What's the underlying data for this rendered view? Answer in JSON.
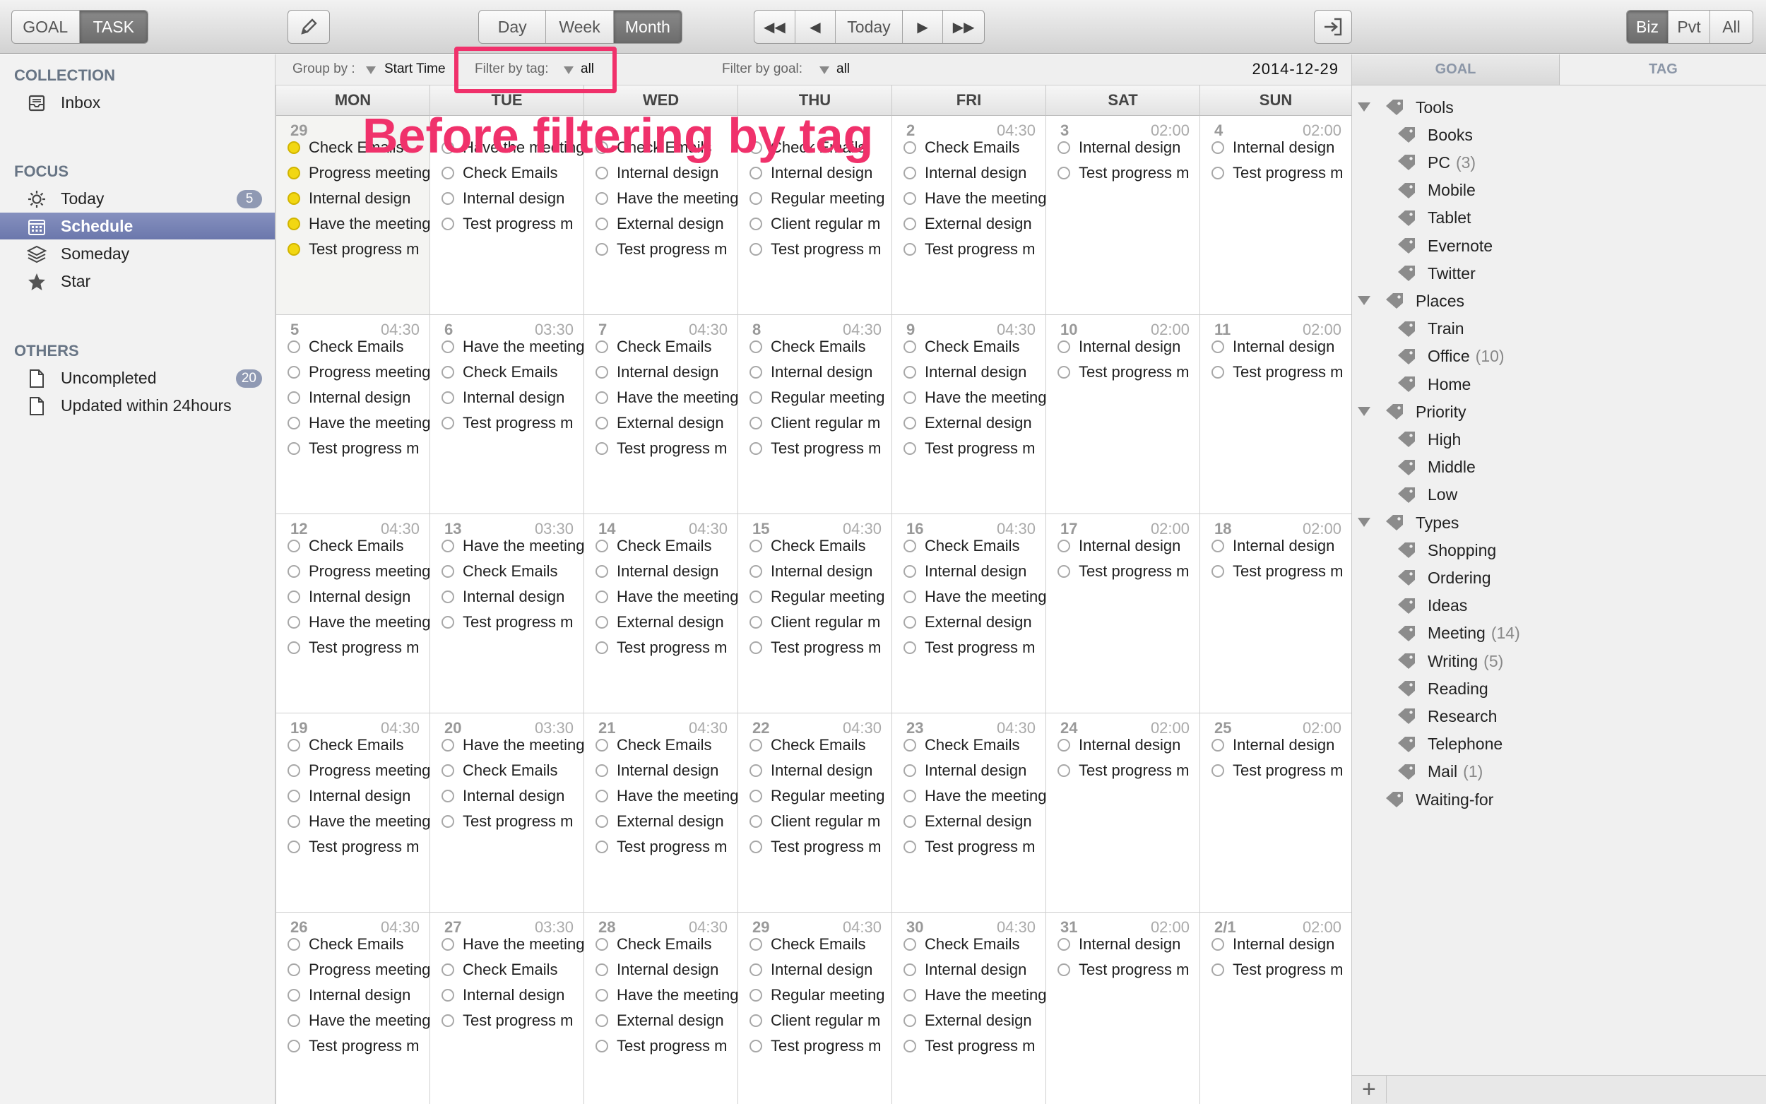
{
  "toolbar": {
    "mode_tabs": [
      "GOAL",
      "TASK"
    ],
    "view_tabs": [
      "Day",
      "Week",
      "Month"
    ],
    "today_label": "Today",
    "scope_tabs": [
      "Biz",
      "Pvt",
      "All"
    ]
  },
  "sidebar": {
    "collection_title": "COLLECTION",
    "inbox_label": "Inbox",
    "focus_title": "FOCUS",
    "focus_items": [
      {
        "label": "Today",
        "badge": "5",
        "icon": "sun-icon"
      },
      {
        "label": "Schedule",
        "icon": "calendar-icon"
      },
      {
        "label": "Someday",
        "icon": "layers-icon"
      },
      {
        "label": "Star",
        "icon": "star-icon"
      }
    ],
    "others_title": "OTHERS",
    "others_items": [
      {
        "label": "Uncompleted",
        "badge": "20",
        "icon": "document-icon"
      },
      {
        "label": "Updated within 24hours",
        "icon": "document-icon"
      }
    ]
  },
  "filter": {
    "group_label": "Group by :",
    "group_value": "Start Time",
    "tag_label": "Filter by tag:",
    "tag_value": "all",
    "goal_label": "Filter by goal:",
    "goal_value": "all",
    "current_date": "2014-12-29"
  },
  "overlay_text": "Before filtering by tag",
  "calendar": {
    "weekdays": [
      "MON",
      "TUE",
      "WED",
      "THU",
      "FRI",
      "SAT",
      "SUN"
    ],
    "weeks": [
      [
        {
          "day": "29",
          "time": "",
          "today": true,
          "tasks": [
            "Check Emails",
            "Progress meeting",
            "Internal design",
            "Have the meeting",
            "Test progress m"
          ]
        },
        {
          "day": "",
          "time": "",
          "tasks": [
            "Have the meeting",
            "Check Emails",
            "Internal design",
            "Test progress m"
          ]
        },
        {
          "day": "",
          "time": "",
          "tasks": [
            "Check Emails",
            "Internal design",
            "Have the meeting",
            "External design",
            "Test progress m"
          ]
        },
        {
          "day": "",
          "time": "",
          "tasks": [
            "Check Emails",
            "Internal design",
            "Regular meeting",
            "Client regular m",
            "Test progress m"
          ]
        },
        {
          "day": "2",
          "time": "04:30",
          "tasks": [
            "Check Emails",
            "Internal design",
            "Have the meeting",
            "External design",
            "Test progress m"
          ]
        },
        {
          "day": "3",
          "time": "02:00",
          "tasks": [
            "Internal design",
            "Test progress m"
          ]
        },
        {
          "day": "4",
          "time": "02:00",
          "tasks": [
            "Internal design",
            "Test progress m"
          ]
        }
      ],
      [
        {
          "day": "5",
          "time": "04:30",
          "tasks": [
            "Check Emails",
            "Progress meeting",
            "Internal design",
            "Have the meeting",
            "Test progress m"
          ]
        },
        {
          "day": "6",
          "time": "03:30",
          "tasks": [
            "Have the meeting",
            "Check Emails",
            "Internal design",
            "Test progress m"
          ]
        },
        {
          "day": "7",
          "time": "04:30",
          "tasks": [
            "Check Emails",
            "Internal design",
            "Have the meeting",
            "External design",
            "Test progress m"
          ]
        },
        {
          "day": "8",
          "time": "04:30",
          "tasks": [
            "Check Emails",
            "Internal design",
            "Regular meeting",
            "Client regular m",
            "Test progress m"
          ]
        },
        {
          "day": "9",
          "time": "04:30",
          "tasks": [
            "Check Emails",
            "Internal design",
            "Have the meeting",
            "External design",
            "Test progress m"
          ]
        },
        {
          "day": "10",
          "time": "02:00",
          "tasks": [
            "Internal design",
            "Test progress m"
          ]
        },
        {
          "day": "11",
          "time": "02:00",
          "tasks": [
            "Internal design",
            "Test progress m"
          ]
        }
      ],
      [
        {
          "day": "12",
          "time": "04:30",
          "tasks": [
            "Check Emails",
            "Progress meeting",
            "Internal design",
            "Have the meeting",
            "Test progress m"
          ]
        },
        {
          "day": "13",
          "time": "03:30",
          "tasks": [
            "Have the meeting",
            "Check Emails",
            "Internal design",
            "Test progress m"
          ]
        },
        {
          "day": "14",
          "time": "04:30",
          "tasks": [
            "Check Emails",
            "Internal design",
            "Have the meeting",
            "External design",
            "Test progress m"
          ]
        },
        {
          "day": "15",
          "time": "04:30",
          "tasks": [
            "Check Emails",
            "Internal design",
            "Regular meeting",
            "Client regular m",
            "Test progress m"
          ]
        },
        {
          "day": "16",
          "time": "04:30",
          "tasks": [
            "Check Emails",
            "Internal design",
            "Have the meeting",
            "External design",
            "Test progress m"
          ]
        },
        {
          "day": "17",
          "time": "02:00",
          "tasks": [
            "Internal design",
            "Test progress m"
          ]
        },
        {
          "day": "18",
          "time": "02:00",
          "tasks": [
            "Internal design",
            "Test progress m"
          ]
        }
      ],
      [
        {
          "day": "19",
          "time": "04:30",
          "tasks": [
            "Check Emails",
            "Progress meeting",
            "Internal design",
            "Have the meeting",
            "Test progress m"
          ]
        },
        {
          "day": "20",
          "time": "03:30",
          "tasks": [
            "Have the meeting",
            "Check Emails",
            "Internal design",
            "Test progress m"
          ]
        },
        {
          "day": "21",
          "time": "04:30",
          "tasks": [
            "Check Emails",
            "Internal design",
            "Have the meeting",
            "External design",
            "Test progress m"
          ]
        },
        {
          "day": "22",
          "time": "04:30",
          "tasks": [
            "Check Emails",
            "Internal design",
            "Regular meeting",
            "Client regular m",
            "Test progress m"
          ]
        },
        {
          "day": "23",
          "time": "04:30",
          "tasks": [
            "Check Emails",
            "Internal design",
            "Have the meeting",
            "External design",
            "Test progress m"
          ]
        },
        {
          "day": "24",
          "time": "02:00",
          "tasks": [
            "Internal design",
            "Test progress m"
          ]
        },
        {
          "day": "25",
          "time": "02:00",
          "tasks": [
            "Internal design",
            "Test progress m"
          ]
        }
      ],
      [
        {
          "day": "26",
          "time": "04:30",
          "tasks": [
            "Check Emails",
            "Progress meeting",
            "Internal design",
            "Have the meeting",
            "Test progress m"
          ]
        },
        {
          "day": "27",
          "time": "03:30",
          "tasks": [
            "Have the meeting",
            "Check Emails",
            "Internal design",
            "Test progress m"
          ]
        },
        {
          "day": "28",
          "time": "04:30",
          "tasks": [
            "Check Emails",
            "Internal design",
            "Have the meeting",
            "External design",
            "Test progress m"
          ]
        },
        {
          "day": "29",
          "time": "04:30",
          "tasks": [
            "Check Emails",
            "Internal design",
            "Regular meeting",
            "Client regular m",
            "Test progress m"
          ]
        },
        {
          "day": "30",
          "time": "04:30",
          "tasks": [
            "Check Emails",
            "Internal design",
            "Have the meeting",
            "External design",
            "Test progress m"
          ]
        },
        {
          "day": "31",
          "time": "02:00",
          "tasks": [
            "Internal design",
            "Test progress m"
          ]
        },
        {
          "day": "2/1",
          "time": "02:00",
          "tasks": [
            "Internal design",
            "Test progress m"
          ]
        }
      ]
    ]
  },
  "right_panel": {
    "tabs": [
      "GOAL",
      "TAG"
    ],
    "tree": [
      {
        "label": "Tools",
        "level": 0,
        "count": ""
      },
      {
        "label": "Books",
        "level": 1,
        "count": ""
      },
      {
        "label": "PC",
        "level": 1,
        "count": "(3)"
      },
      {
        "label": "Mobile",
        "level": 1,
        "count": ""
      },
      {
        "label": "Tablet",
        "level": 1,
        "count": ""
      },
      {
        "label": "Evernote",
        "level": 1,
        "count": ""
      },
      {
        "label": "Twitter",
        "level": 1,
        "count": ""
      },
      {
        "label": "Places",
        "level": 0,
        "count": ""
      },
      {
        "label": "Train",
        "level": 1,
        "count": ""
      },
      {
        "label": "Office",
        "level": 1,
        "count": "(10)"
      },
      {
        "label": "Home",
        "level": 1,
        "count": ""
      },
      {
        "label": "Priority",
        "level": 0,
        "count": ""
      },
      {
        "label": "High",
        "level": 1,
        "count": ""
      },
      {
        "label": "Middle",
        "level": 1,
        "count": ""
      },
      {
        "label": "Low",
        "level": 1,
        "count": ""
      },
      {
        "label": "Types",
        "level": 0,
        "count": ""
      },
      {
        "label": "Shopping",
        "level": 1,
        "count": ""
      },
      {
        "label": "Ordering",
        "level": 1,
        "count": ""
      },
      {
        "label": "Ideas",
        "level": 1,
        "count": ""
      },
      {
        "label": "Meeting",
        "level": 1,
        "count": "(14)"
      },
      {
        "label": "Writing",
        "level": 1,
        "count": "(5)"
      },
      {
        "label": "Reading",
        "level": 1,
        "count": ""
      },
      {
        "label": "Research",
        "level": 1,
        "count": ""
      },
      {
        "label": "Telephone",
        "level": 1,
        "count": ""
      },
      {
        "label": "Mail",
        "level": 1,
        "count": "(1)"
      },
      {
        "label": "Waiting-for",
        "level": 0,
        "count": "",
        "leaf": true
      }
    ]
  },
  "colors": {
    "accent": "#f0316b",
    "selection": "#6b77ac",
    "today_dot": "#f2d712"
  }
}
